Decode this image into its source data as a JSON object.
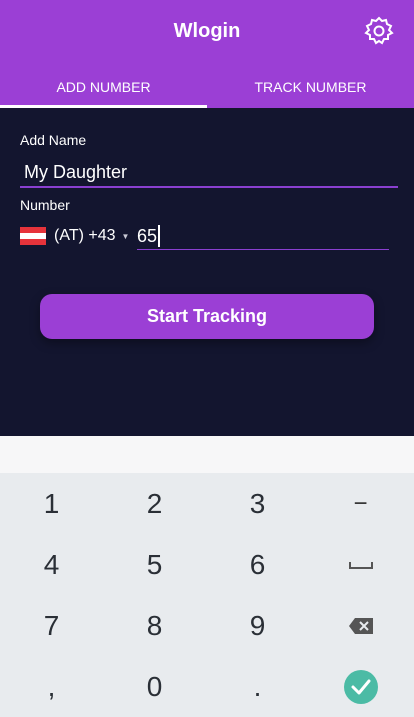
{
  "header": {
    "title": "Wlogin",
    "settings_icon": "gear-icon"
  },
  "tabs": [
    {
      "label": "ADD NUMBER",
      "active": true
    },
    {
      "label": "TRACK NUMBER",
      "active": false
    }
  ],
  "form": {
    "name_label": "Add Name",
    "name_value": "My Daughter",
    "number_label": "Number",
    "country_flag": "austria-flag",
    "country_code": "(AT) +43",
    "number_value": "65",
    "start_button": "Start Tracking"
  },
  "keypad": {
    "row1": [
      "1",
      "2",
      "3",
      "−"
    ],
    "row2": [
      "4",
      "5",
      "6",
      "␣"
    ],
    "row3": [
      "7",
      "8",
      "9",
      "⌫"
    ],
    "row4": [
      ",",
      "0",
      ".",
      "✓"
    ]
  },
  "colors": {
    "accent": "#9b3fd5",
    "background": "#13152f",
    "keypad": "#e8ebee",
    "confirm": "#4bbba5"
  }
}
